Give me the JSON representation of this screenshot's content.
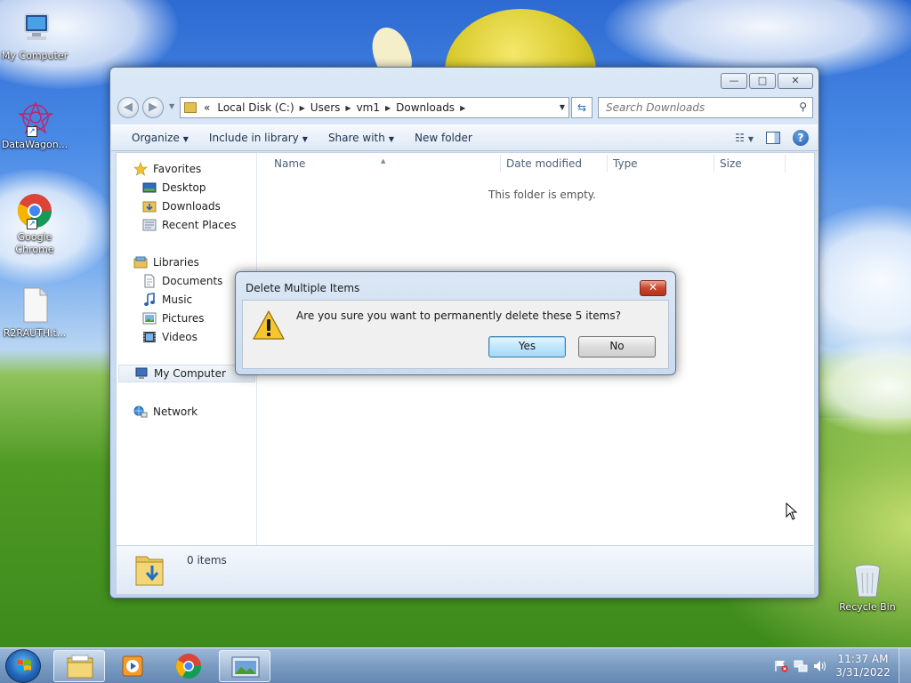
{
  "desktop": {
    "icons": [
      {
        "label": "My Computer",
        "icon": "computer-icon"
      },
      {
        "label": "DataWagon...",
        "icon": "datawagon-icon"
      },
      {
        "label": "Google Chrome",
        "icon": "chrome-icon"
      },
      {
        "label": "R2RAUTH.t...",
        "icon": "text-file-icon"
      },
      {
        "label": "Recycle Bin",
        "icon": "recycle-bin-icon"
      }
    ]
  },
  "explorer": {
    "window_controls": {
      "minimize": "—",
      "maximize": "□",
      "close": "✕"
    },
    "address": {
      "prefix": "«",
      "segments": [
        "Local Disk (C:)",
        "Users",
        "vm1",
        "Downloads"
      ]
    },
    "search": {
      "placeholder": "Search Downloads"
    },
    "toolbar": {
      "organize": "Organize",
      "include_in_library": "Include in library",
      "share_with": "Share with",
      "new_folder": "New folder"
    },
    "nav": {
      "favorites": "Favorites",
      "desktop": "Desktop",
      "downloads": "Downloads",
      "recent_places": "Recent Places",
      "libraries": "Libraries",
      "documents": "Documents",
      "music": "Music",
      "pictures": "Pictures",
      "videos": "Videos",
      "my_computer": "My Computer",
      "network": "Network"
    },
    "columns": {
      "name": "Name",
      "date_modified": "Date modified",
      "type": "Type",
      "size": "Size"
    },
    "empty_message": "This folder is empty.",
    "status": {
      "item_count": "0 items"
    }
  },
  "dialog": {
    "title": "Delete Multiple Items",
    "message": "Are you sure you want to permanently delete these 5 items?",
    "yes": "Yes",
    "no": "No"
  },
  "taskbar": {
    "clock_time": "11:37 AM",
    "clock_date": "3/31/2022"
  }
}
